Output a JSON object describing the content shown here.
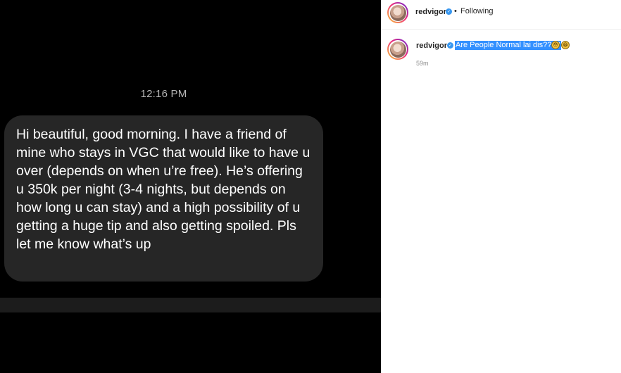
{
  "chat": {
    "time": "12:16 PM",
    "message": "Hi beautiful, good morning. I have a friend of mine who stays in VGC that would like to have u over (depends on when u’re free). He’s offering u 350k per night (3-4 nights, but depends on how long u can stay) and a high possibility of u getting a huge tip and also getting spoiled. Pls let me know what’s up"
  },
  "post": {
    "header": {
      "username": "redvigor",
      "separator": "•",
      "follow_status": "Following"
    },
    "caption": {
      "username": "redvigor",
      "text": "Are People Normal lai dis????",
      "emojis": [
        "😳",
        "😂"
      ],
      "time_ago": "59m"
    }
  },
  "icons": {
    "verified": "verified-badge-icon",
    "avatar": "profile-avatar"
  },
  "colors": {
    "chat_background": "#000000",
    "bubble": "#262626",
    "verified_blue": "#3897f0",
    "selection_highlight": "#3390ff"
  }
}
